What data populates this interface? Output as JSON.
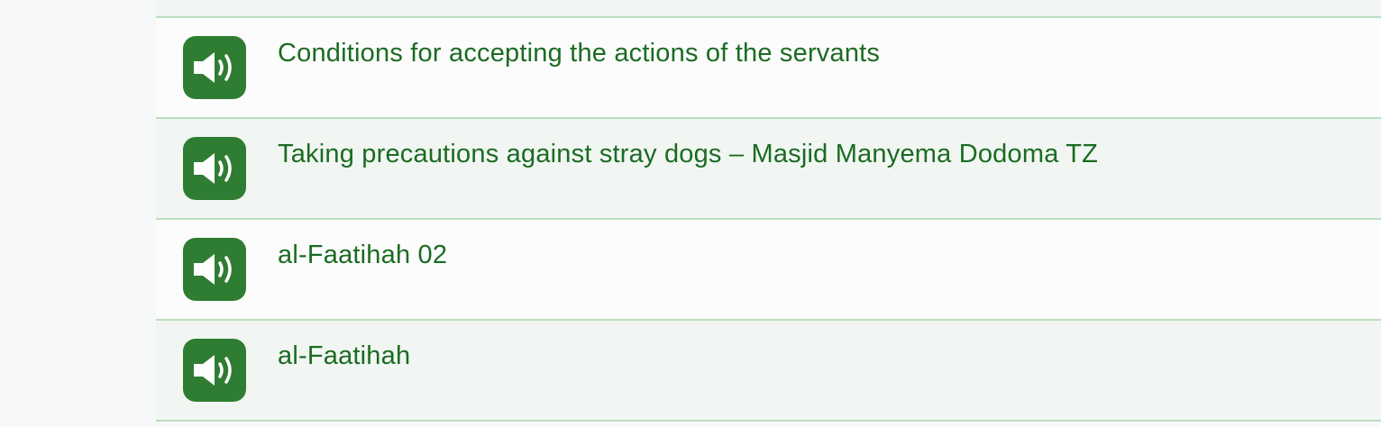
{
  "colors": {
    "accent": "#2e7d32",
    "title_text": "#1b6b22",
    "row_alt_bg": "#f1f6f2",
    "divider": "#b9dfbd"
  },
  "audio_list": {
    "items": [
      {
        "title": "Conditions for accepting the actions of the servants",
        "icon": "speaker-icon"
      },
      {
        "title": "Taking precautions against stray dogs – Masjid Manyema Dodoma TZ",
        "icon": "speaker-icon"
      },
      {
        "title": "al-Faatihah 02",
        "icon": "speaker-icon"
      },
      {
        "title": "al-Faatihah",
        "icon": "speaker-icon"
      }
    ]
  }
}
